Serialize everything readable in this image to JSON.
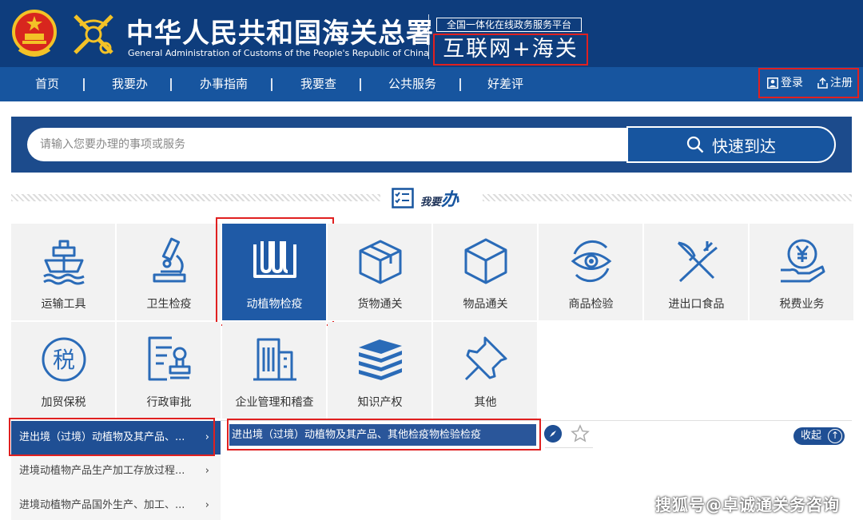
{
  "header": {
    "title_cn": "中华人民共和国海关总署",
    "title_en": "General Administration of Customs of the People's Republic of China",
    "platform_tag": "全国一体化在线政务服务平台",
    "platform_name": "互联网+海关"
  },
  "nav": {
    "items": [
      "首页",
      "我要办",
      "办事指南",
      "我要查",
      "公共服务",
      "好差评"
    ],
    "login": "登录",
    "register": "注册"
  },
  "search": {
    "placeholder": "请输入您要办理的事项或服务",
    "button": "快速到达"
  },
  "section": {
    "title_small": "我要",
    "title_big": "办"
  },
  "tiles": [
    {
      "label": "运输工具",
      "icon": "ship-icon"
    },
    {
      "label": "卫生检疫",
      "icon": "microscope-icon"
    },
    {
      "label": "动植物检疫",
      "icon": "test-tubes-icon",
      "active": true
    },
    {
      "label": "货物通关",
      "icon": "box-icon"
    },
    {
      "label": "物品通关",
      "icon": "cube-icon"
    },
    {
      "label": "商品检验",
      "icon": "eye-icon"
    },
    {
      "label": "进出口食品",
      "icon": "fork-knife-icon"
    },
    {
      "label": "税费业务",
      "icon": "yuan-hand-icon"
    },
    {
      "label": "加贸保税",
      "icon": "tax-icon"
    },
    {
      "label": "行政审批",
      "icon": "approval-stamp-icon"
    },
    {
      "label": "企业管理和稽查",
      "icon": "building-icon"
    },
    {
      "label": "知识产权",
      "icon": "books-icon"
    },
    {
      "label": "其他",
      "icon": "pin-icon"
    }
  ],
  "submenu": [
    "进出境（过境）动植物及其产品、...",
    "进境动植物产品生产加工存放过程...",
    "进境动植物产品国外生产、加工、..."
  ],
  "detail": {
    "item": "进出境（过境）动植物及其产品、其他检疫物检验检疫",
    "collapse": "收起"
  },
  "watermark": "搜狐号@卓诚通关务咨询",
  "colors": {
    "header_bg": "#0e3d7d",
    "nav_bg": "#17559f",
    "accent": "#1f5aa6",
    "highlight_box": "#e02020"
  }
}
